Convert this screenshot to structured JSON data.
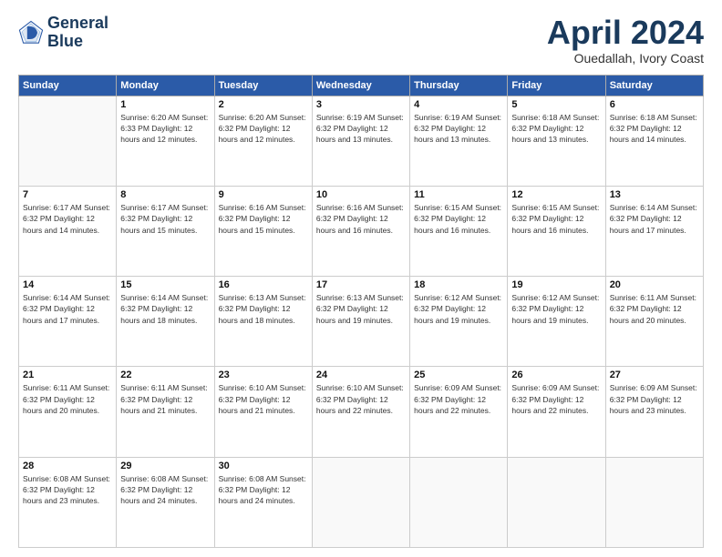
{
  "header": {
    "logo_line1": "General",
    "logo_line2": "Blue",
    "month_title": "April 2024",
    "location": "Ouedallah, Ivory Coast"
  },
  "weekdays": [
    "Sunday",
    "Monday",
    "Tuesday",
    "Wednesday",
    "Thursday",
    "Friday",
    "Saturday"
  ],
  "weeks": [
    [
      {
        "day": "",
        "info": ""
      },
      {
        "day": "1",
        "info": "Sunrise: 6:20 AM\nSunset: 6:33 PM\nDaylight: 12 hours\nand 12 minutes."
      },
      {
        "day": "2",
        "info": "Sunrise: 6:20 AM\nSunset: 6:32 PM\nDaylight: 12 hours\nand 12 minutes."
      },
      {
        "day": "3",
        "info": "Sunrise: 6:19 AM\nSunset: 6:32 PM\nDaylight: 12 hours\nand 13 minutes."
      },
      {
        "day": "4",
        "info": "Sunrise: 6:19 AM\nSunset: 6:32 PM\nDaylight: 12 hours\nand 13 minutes."
      },
      {
        "day": "5",
        "info": "Sunrise: 6:18 AM\nSunset: 6:32 PM\nDaylight: 12 hours\nand 13 minutes."
      },
      {
        "day": "6",
        "info": "Sunrise: 6:18 AM\nSunset: 6:32 PM\nDaylight: 12 hours\nand 14 minutes."
      }
    ],
    [
      {
        "day": "7",
        "info": "Sunrise: 6:17 AM\nSunset: 6:32 PM\nDaylight: 12 hours\nand 14 minutes."
      },
      {
        "day": "8",
        "info": "Sunrise: 6:17 AM\nSunset: 6:32 PM\nDaylight: 12 hours\nand 15 minutes."
      },
      {
        "day": "9",
        "info": "Sunrise: 6:16 AM\nSunset: 6:32 PM\nDaylight: 12 hours\nand 15 minutes."
      },
      {
        "day": "10",
        "info": "Sunrise: 6:16 AM\nSunset: 6:32 PM\nDaylight: 12 hours\nand 16 minutes."
      },
      {
        "day": "11",
        "info": "Sunrise: 6:15 AM\nSunset: 6:32 PM\nDaylight: 12 hours\nand 16 minutes."
      },
      {
        "day": "12",
        "info": "Sunrise: 6:15 AM\nSunset: 6:32 PM\nDaylight: 12 hours\nand 16 minutes."
      },
      {
        "day": "13",
        "info": "Sunrise: 6:14 AM\nSunset: 6:32 PM\nDaylight: 12 hours\nand 17 minutes."
      }
    ],
    [
      {
        "day": "14",
        "info": "Sunrise: 6:14 AM\nSunset: 6:32 PM\nDaylight: 12 hours\nand 17 minutes."
      },
      {
        "day": "15",
        "info": "Sunrise: 6:14 AM\nSunset: 6:32 PM\nDaylight: 12 hours\nand 18 minutes."
      },
      {
        "day": "16",
        "info": "Sunrise: 6:13 AM\nSunset: 6:32 PM\nDaylight: 12 hours\nand 18 minutes."
      },
      {
        "day": "17",
        "info": "Sunrise: 6:13 AM\nSunset: 6:32 PM\nDaylight: 12 hours\nand 19 minutes."
      },
      {
        "day": "18",
        "info": "Sunrise: 6:12 AM\nSunset: 6:32 PM\nDaylight: 12 hours\nand 19 minutes."
      },
      {
        "day": "19",
        "info": "Sunrise: 6:12 AM\nSunset: 6:32 PM\nDaylight: 12 hours\nand 19 minutes."
      },
      {
        "day": "20",
        "info": "Sunrise: 6:11 AM\nSunset: 6:32 PM\nDaylight: 12 hours\nand 20 minutes."
      }
    ],
    [
      {
        "day": "21",
        "info": "Sunrise: 6:11 AM\nSunset: 6:32 PM\nDaylight: 12 hours\nand 20 minutes."
      },
      {
        "day": "22",
        "info": "Sunrise: 6:11 AM\nSunset: 6:32 PM\nDaylight: 12 hours\nand 21 minutes."
      },
      {
        "day": "23",
        "info": "Sunrise: 6:10 AM\nSunset: 6:32 PM\nDaylight: 12 hours\nand 21 minutes."
      },
      {
        "day": "24",
        "info": "Sunrise: 6:10 AM\nSunset: 6:32 PM\nDaylight: 12 hours\nand 22 minutes."
      },
      {
        "day": "25",
        "info": "Sunrise: 6:09 AM\nSunset: 6:32 PM\nDaylight: 12 hours\nand 22 minutes."
      },
      {
        "day": "26",
        "info": "Sunrise: 6:09 AM\nSunset: 6:32 PM\nDaylight: 12 hours\nand 22 minutes."
      },
      {
        "day": "27",
        "info": "Sunrise: 6:09 AM\nSunset: 6:32 PM\nDaylight: 12 hours\nand 23 minutes."
      }
    ],
    [
      {
        "day": "28",
        "info": "Sunrise: 6:08 AM\nSunset: 6:32 PM\nDaylight: 12 hours\nand 23 minutes."
      },
      {
        "day": "29",
        "info": "Sunrise: 6:08 AM\nSunset: 6:32 PM\nDaylight: 12 hours\nand 24 minutes."
      },
      {
        "day": "30",
        "info": "Sunrise: 6:08 AM\nSunset: 6:32 PM\nDaylight: 12 hours\nand 24 minutes."
      },
      {
        "day": "",
        "info": ""
      },
      {
        "day": "",
        "info": ""
      },
      {
        "day": "",
        "info": ""
      },
      {
        "day": "",
        "info": ""
      }
    ]
  ]
}
